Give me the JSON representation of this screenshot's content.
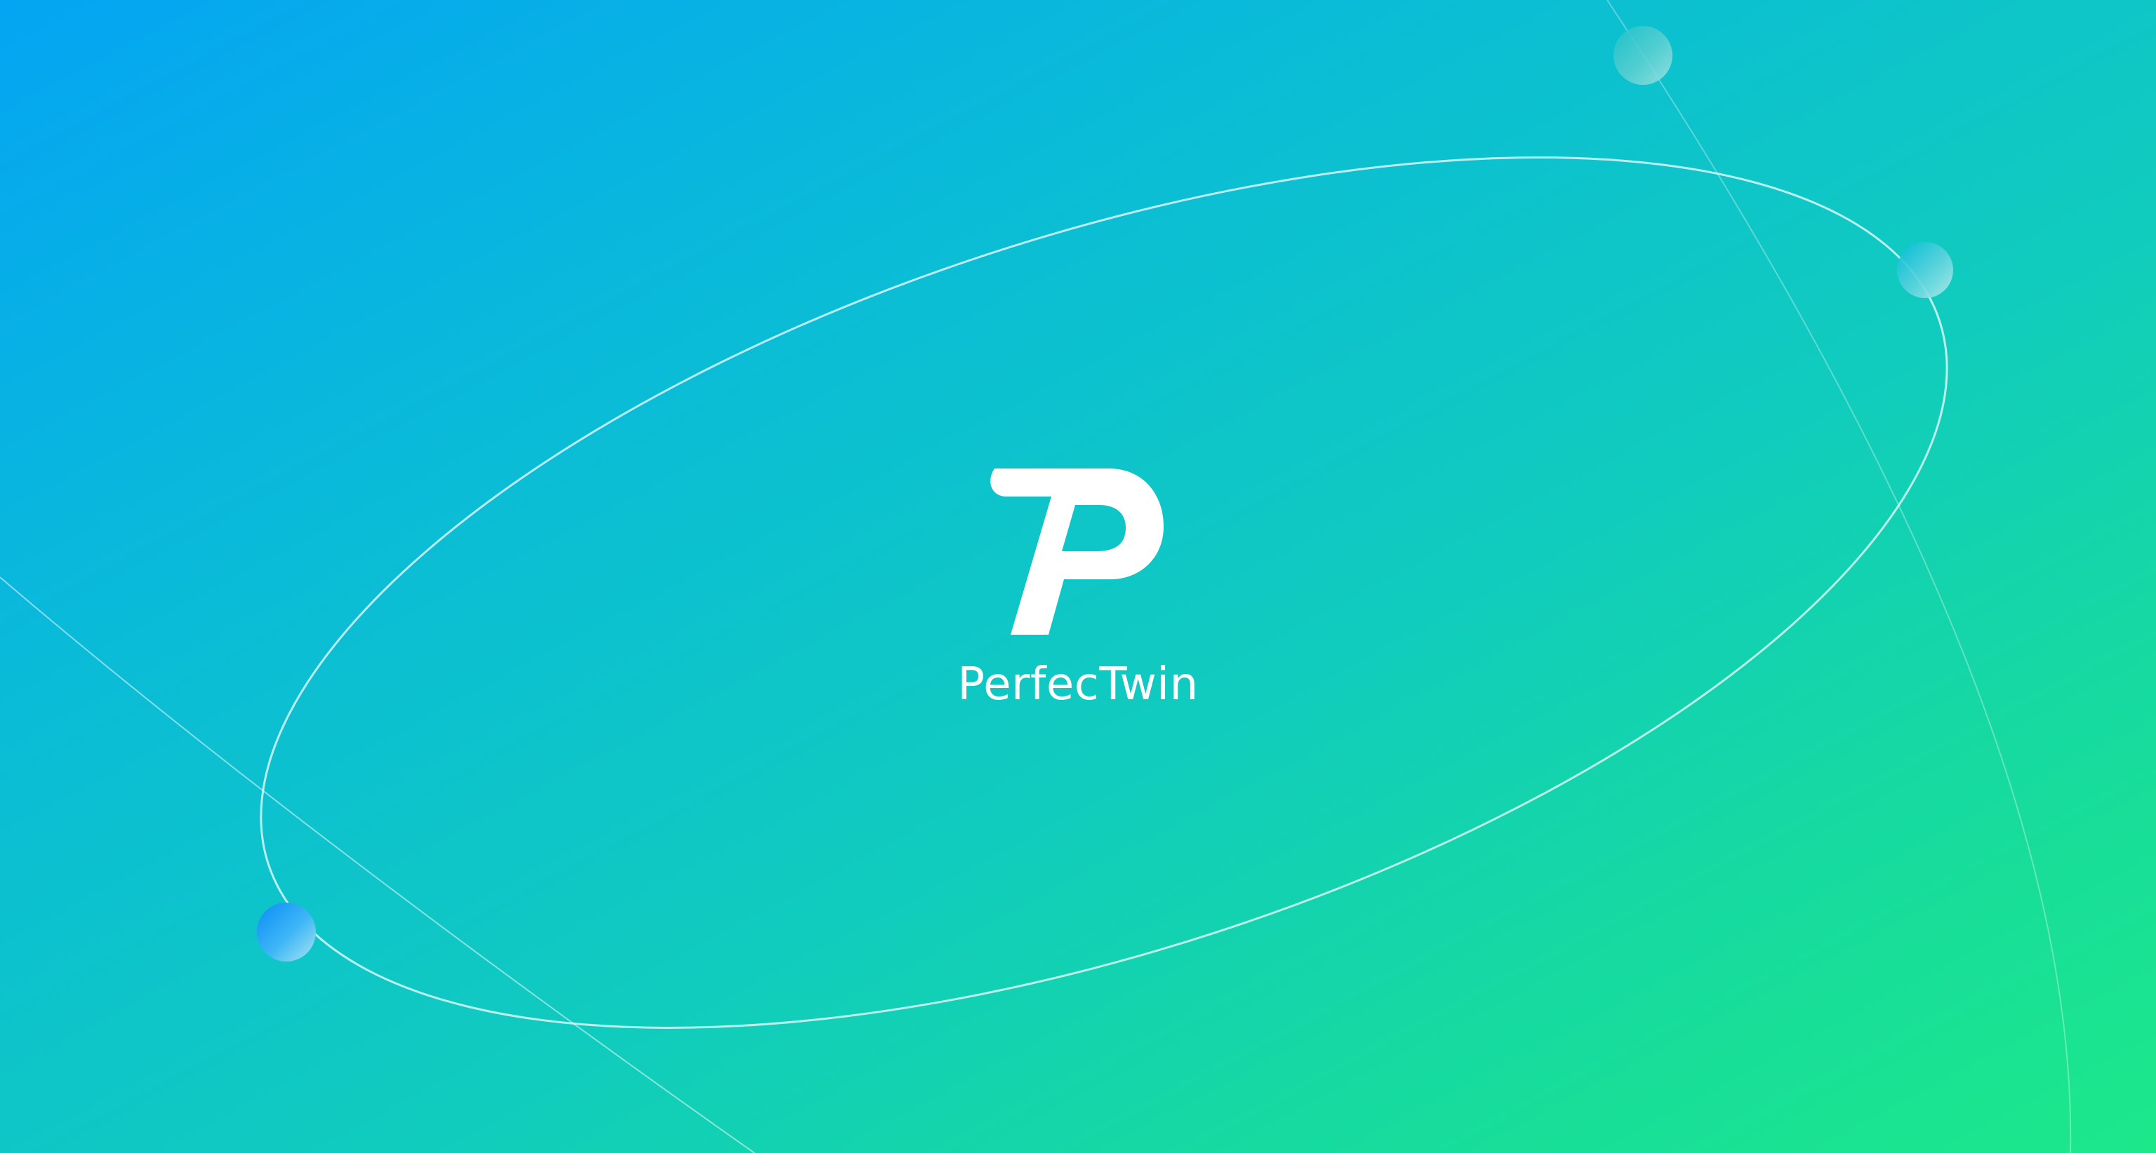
{
  "app": {
    "name": "PerfecTwin",
    "logo_icon": "perfectwin-p-logo-icon"
  },
  "colors": {
    "gradient_start": "#04a5f3",
    "gradient_end": "#1ce88a",
    "logo": "#ffffff",
    "text": "#ffffff"
  }
}
